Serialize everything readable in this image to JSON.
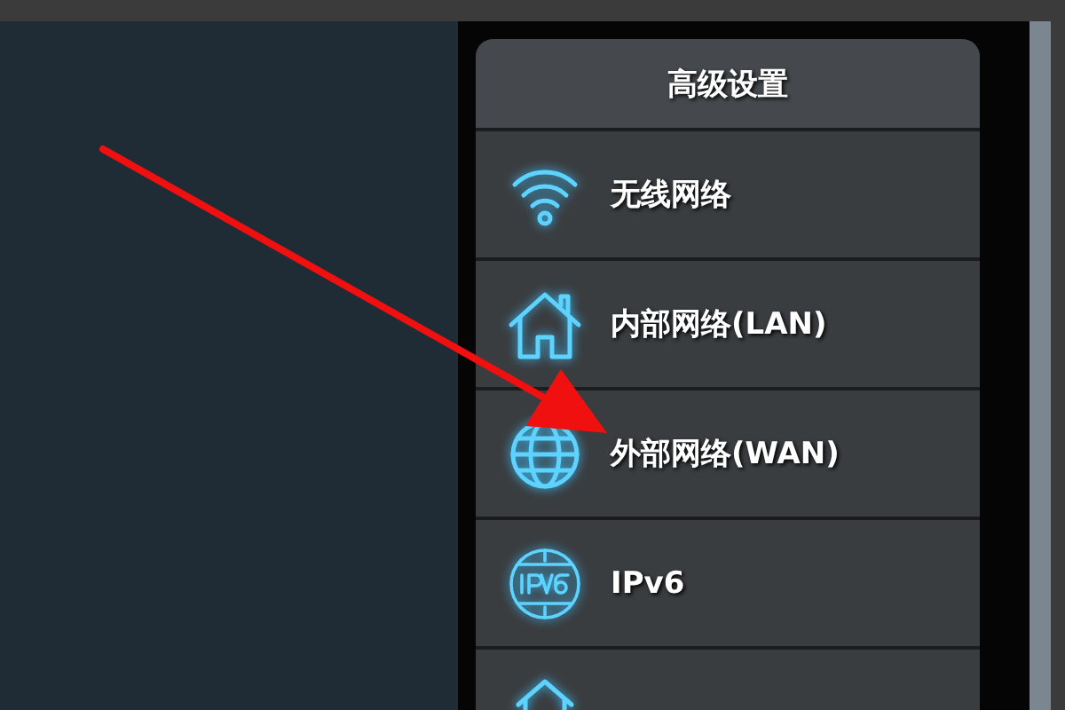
{
  "menu": {
    "title": "高级设置",
    "items": [
      {
        "kind": "wifi",
        "label": "无线网络"
      },
      {
        "kind": "home",
        "label": "内部网络(LAN)"
      },
      {
        "kind": "globe",
        "label": "外部网络(WAN)"
      },
      {
        "kind": "ipv6",
        "label": "IPv6"
      },
      {
        "kind": "partial"
      }
    ]
  }
}
